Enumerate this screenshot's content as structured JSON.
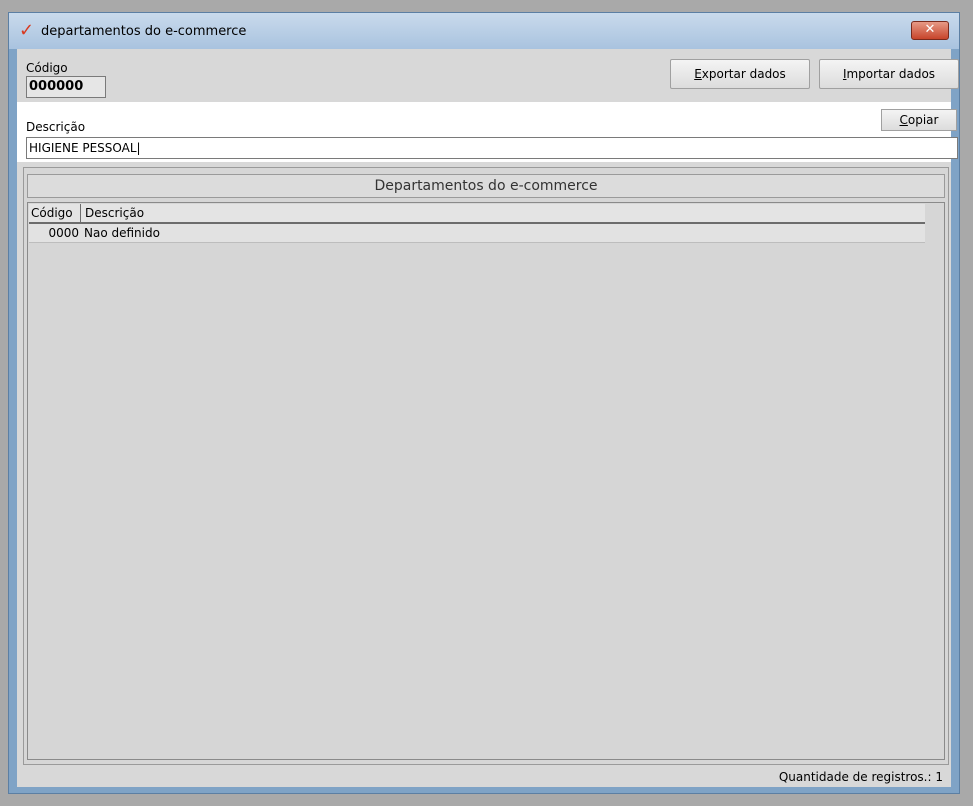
{
  "window": {
    "title": "departamentos do e-commerce",
    "close_label": "✕"
  },
  "form": {
    "codigo_label": "Código",
    "codigo_value": "000000",
    "descricao_label": "Descrição",
    "descricao_value": "HIGIENE PESSOAL"
  },
  "buttons": {
    "exportar_first": "E",
    "exportar_rest": "xportar dados",
    "importar_first": "I",
    "importar_rest": "mportar dados",
    "copiar_first": "C",
    "copiar_rest": "opiar"
  },
  "grid": {
    "title": "Departamentos do e-commerce",
    "columns": [
      "Código",
      "Descrição"
    ],
    "rows": [
      {
        "codigo": "0000",
        "descricao": "Nao definido"
      }
    ]
  },
  "status": {
    "count_text": "Quantidade de registros.: 1"
  },
  "colors": {
    "accent": "#d83a20",
    "window_frame": "#7fa3c6",
    "client_bg": "#d8d8d8"
  }
}
